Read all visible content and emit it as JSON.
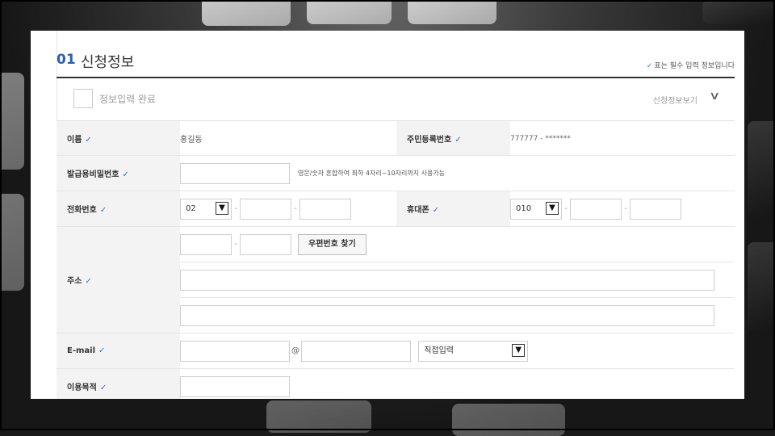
{
  "section": {
    "number": "01",
    "title": "신청정보",
    "required_note": "표는 필수 입력 정보입니다",
    "required_mark": "✓"
  },
  "complete": {
    "label": "정보입력 완료",
    "view_label": "신청정보보기"
  },
  "form": {
    "name": {
      "label": "이름",
      "value": "홍길동"
    },
    "rrn": {
      "label": "주민등록번호",
      "value": "777777 - *******"
    },
    "password": {
      "label": "발급용비밀번호",
      "hint": "영문/숫자 혼합하여 최하 4자리~10자리까지 사용가능"
    },
    "phone": {
      "label": "전화번호",
      "area_code": "02"
    },
    "mobile": {
      "label": "휴대폰",
      "prefix": "010"
    },
    "address": {
      "label": "주소",
      "zip_button": "우편번호 찾기"
    },
    "email": {
      "label": "E-mail",
      "at": "@",
      "domain_select": "직접입력"
    },
    "purpose": {
      "label": "이용목적"
    }
  },
  "colors": {
    "accent": "#2f5fb0",
    "check": "#2f72d8"
  }
}
